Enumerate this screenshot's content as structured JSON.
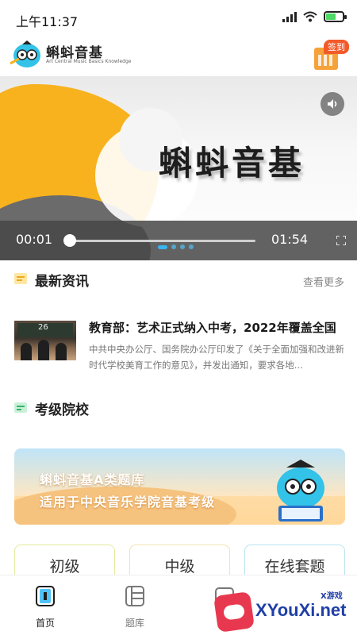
{
  "status_bar": {
    "time": "上午11:37"
  },
  "header": {
    "app_name": "蝌蚪音基",
    "app_subtitle": "Art Central Music Basics Knowledge",
    "signin_label": "签到"
  },
  "video": {
    "title_text": "蝌蚪音基",
    "current_time": "00:01",
    "duration": "01:54",
    "progress": 0.01,
    "slide_count": 4,
    "active_slide": 0
  },
  "news_section": {
    "title": "最新资讯",
    "more_label": "查看更多",
    "item": {
      "headline": "教育部：艺术正式纳入中考，2022年覆盖全国",
      "summary": "中共中央办公厅、国务院办公厅印发了《关于全面加强和改进新时代学校美育工作的意见》，并发出通知，要求各地...",
      "thumb_board_text": "26"
    }
  },
  "exam_section": {
    "title": "考级院校",
    "banner": {
      "line1": "蝌蚪音基A类题库",
      "line2": "适用于中央音乐学院音基考级"
    },
    "levels": [
      "初级",
      "中级",
      "在线套题"
    ]
  },
  "tabbar": {
    "tabs": [
      {
        "label": "首页",
        "icon": "home-icon",
        "active": true
      },
      {
        "label": "题库",
        "icon": "question-bank-icon",
        "active": false
      },
      {
        "label": "学",
        "icon": "study-icon",
        "active": false
      }
    ]
  },
  "watermark": {
    "site": "XYouXi.net",
    "tag": "X游戏"
  },
  "colors": {
    "accent": "#39b4f0",
    "brand_yellow": "#f7b21e",
    "signin_red": "#f25a2a"
  }
}
